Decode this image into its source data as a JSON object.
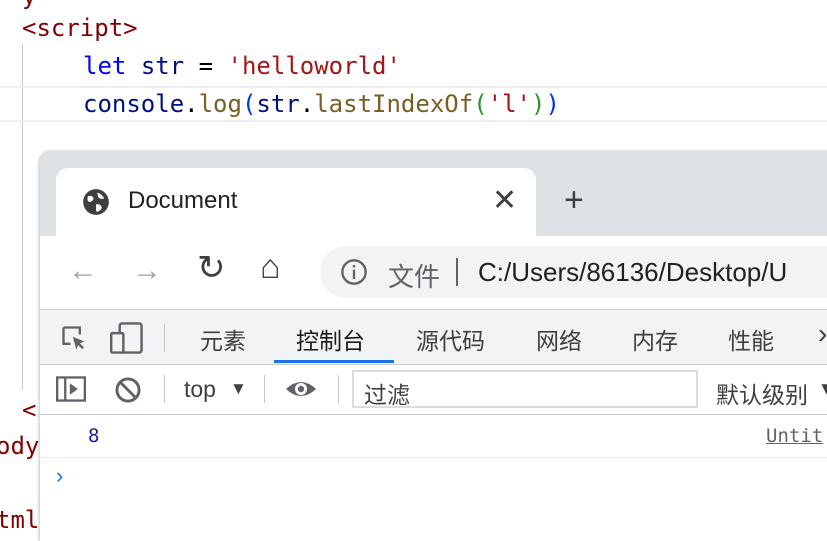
{
  "editor": {
    "line1": "y",
    "script_open": "<script>",
    "line_let": {
      "kw": "let",
      "name": "str",
      "eq": " = ",
      "value": "'helloworld'"
    },
    "line_console": {
      "obj": "console",
      "dot": ".",
      "fn": "log",
      "p1": "(",
      "arg": "str",
      "dot2": ".",
      "method": "lastIndexOf",
      "p2": "(",
      "argval": "'l'",
      "p3": ")",
      "p4": ")"
    },
    "left_close": "<",
    "left_body": "ody",
    "left_html": "tml"
  },
  "browser": {
    "tab_title": "Document",
    "tab_close": "✕",
    "new_tab": "+",
    "omnibox": {
      "file_label": "文件",
      "url": "C:/Users/86136/Desktop/U"
    },
    "nav": {
      "back": "←",
      "forward": "→",
      "reload": "↻",
      "home": "⌂"
    }
  },
  "devtools": {
    "tabs": [
      "元素",
      "控制台",
      "源代码",
      "网络",
      "内存",
      "性能"
    ],
    "active_tab": "控制台",
    "more": "›",
    "console_toolbar": {
      "context": "top",
      "context_caret": "▼",
      "filter_placeholder": "过滤",
      "levels": "默认级别",
      "levels_caret": "▼"
    },
    "console": {
      "output_value": "8",
      "output_source": "Untit",
      "prompt": "›"
    }
  },
  "colors": {
    "accent": "#1a73e8",
    "tag": "#800000",
    "keyword": "#0000ff",
    "string": "#a31515"
  }
}
